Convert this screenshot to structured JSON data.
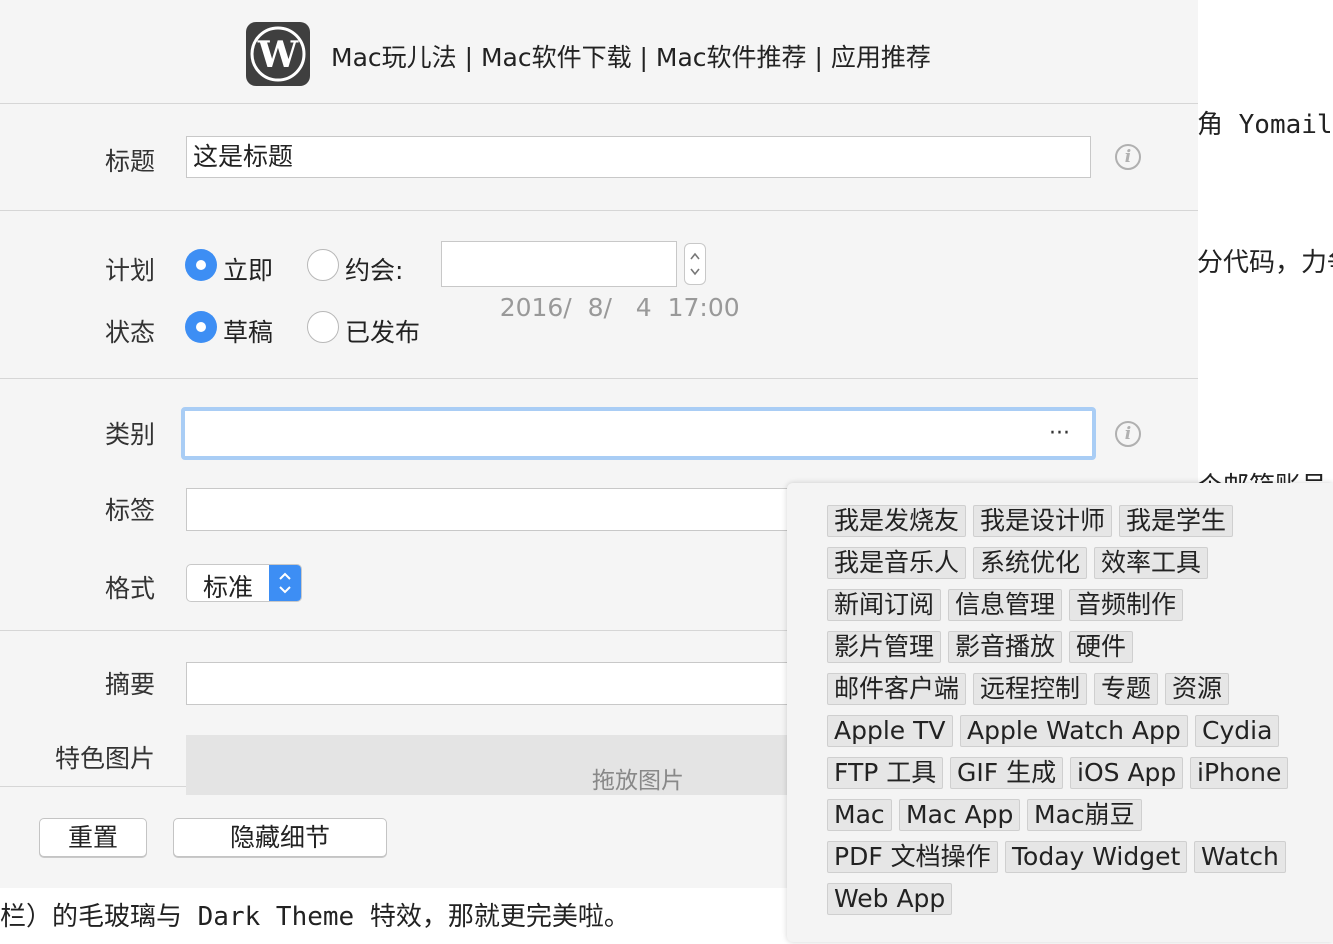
{
  "background_text": {
    "line1": "角 Yomail",
    "line2": "分代码，力争",
    "line3": "个邮箱账号",
    "bottom": "栏）的毛玻璃与 Dark Theme 特效，那就更完美啦。"
  },
  "header": {
    "site_title": "Mac玩儿法 | Mac软件下载 | Mac软件推荐 | 应用推荐",
    "logo_icon": "wordpress-icon"
  },
  "form": {
    "title_label": "标题",
    "title_value": "这是标题",
    "schedule_label": "计划",
    "schedule_now": "立即",
    "schedule_date": "约会:",
    "datetime_value": "2016/  8/   4  17:00",
    "status_label": "状态",
    "status_draft": "草稿",
    "status_published": "已发布",
    "category_label": "类别",
    "category_more": "···",
    "tags_label": "标签",
    "format_label": "格式",
    "format_value": "标准",
    "excerpt_label": "摘要",
    "featured_label": "特色图片",
    "drop_image": "拖放图片"
  },
  "buttons": {
    "reset": "重置",
    "hide_details": "隐藏细节"
  },
  "category_tags": [
    [
      "我是发烧友",
      "我是设计师",
      "我是学生"
    ],
    [
      "我是音乐人",
      "系统优化",
      "效率工具"
    ],
    [
      "新闻订阅",
      "信息管理",
      "音频制作"
    ],
    [
      "影片管理",
      "影音播放",
      "硬件"
    ],
    [
      "邮件客户端",
      "远程控制",
      "专题",
      "资源"
    ],
    [
      "Apple TV",
      "Apple Watch App",
      "Cydia"
    ],
    [
      "FTP 工具",
      "GIF 生成",
      "iOS App",
      "iPhone"
    ],
    [
      "Mac",
      "Mac App",
      "Mac崩豆"
    ],
    [
      "PDF 文档操作",
      "Today Widget",
      "Watch"
    ],
    [
      "Web App"
    ]
  ],
  "colors": {
    "accent": "#3d8ef4",
    "focus_ring": "#a9cdf5"
  }
}
